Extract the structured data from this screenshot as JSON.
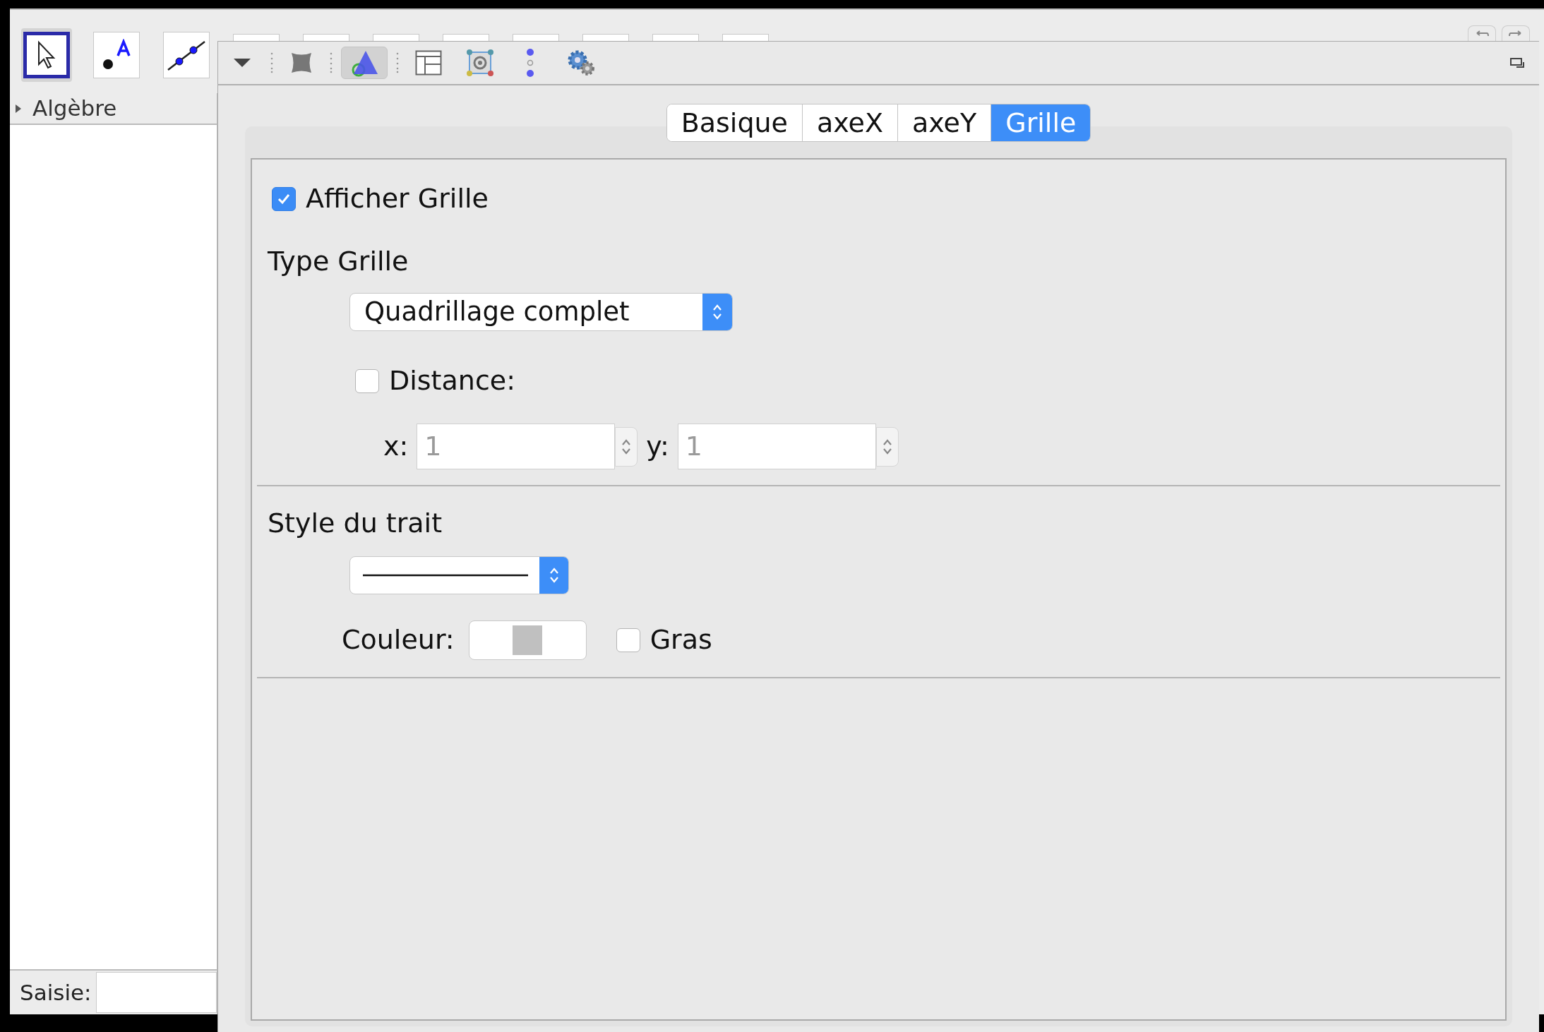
{
  "toolbar": {
    "tools": [
      {
        "kind": "move",
        "selected": true
      },
      {
        "kind": "point",
        "selected": false
      },
      {
        "kind": "line",
        "selected": false
      },
      {
        "kind": "covered",
        "selected": false
      },
      {
        "kind": "covered",
        "selected": false
      },
      {
        "kind": "covered",
        "selected": false
      },
      {
        "kind": "covered",
        "selected": false
      },
      {
        "kind": "covered",
        "selected": false
      },
      {
        "kind": "covered",
        "selected": false
      },
      {
        "kind": "covered",
        "selected": false
      },
      {
        "kind": "covered",
        "selected": false
      }
    ]
  },
  "algebra_view": {
    "title": "Algèbre",
    "expanded": false
  },
  "input_bar": {
    "label": "Saisie:"
  },
  "settings": {
    "toolbar": [
      {
        "kind": "menu",
        "selected": false
      },
      {
        "kind": "separator"
      },
      {
        "kind": "square",
        "selected": false
      },
      {
        "kind": "separator"
      },
      {
        "kind": "triangle",
        "selected": true
      },
      {
        "kind": "separator"
      },
      {
        "kind": "layout",
        "selected": false
      },
      {
        "kind": "graphics",
        "selected": false
      },
      {
        "kind": "dots",
        "selected": false
      },
      {
        "kind": "gears",
        "selected": false
      }
    ],
    "tabs": [
      {
        "label": "Basique",
        "selected": false
      },
      {
        "label": "axeX",
        "selected": false
      },
      {
        "label": "axeY",
        "selected": false
      },
      {
        "label": "Grille",
        "selected": true
      }
    ],
    "show_grid": {
      "label": "Afficher Grille",
      "checked": true
    },
    "grid_type": {
      "label": "Type Grille",
      "value": "Quadrillage complet"
    },
    "distance": {
      "label": "Distance:",
      "checked": false
    },
    "x": {
      "label": "x:",
      "value": "1",
      "disabled": true
    },
    "y": {
      "label": "y:",
      "value": "1",
      "disabled": true
    },
    "line_style": {
      "label": "Style du trait"
    },
    "color": {
      "label": "Couleur:"
    },
    "bold": {
      "label": "Gras",
      "checked": false
    }
  }
}
